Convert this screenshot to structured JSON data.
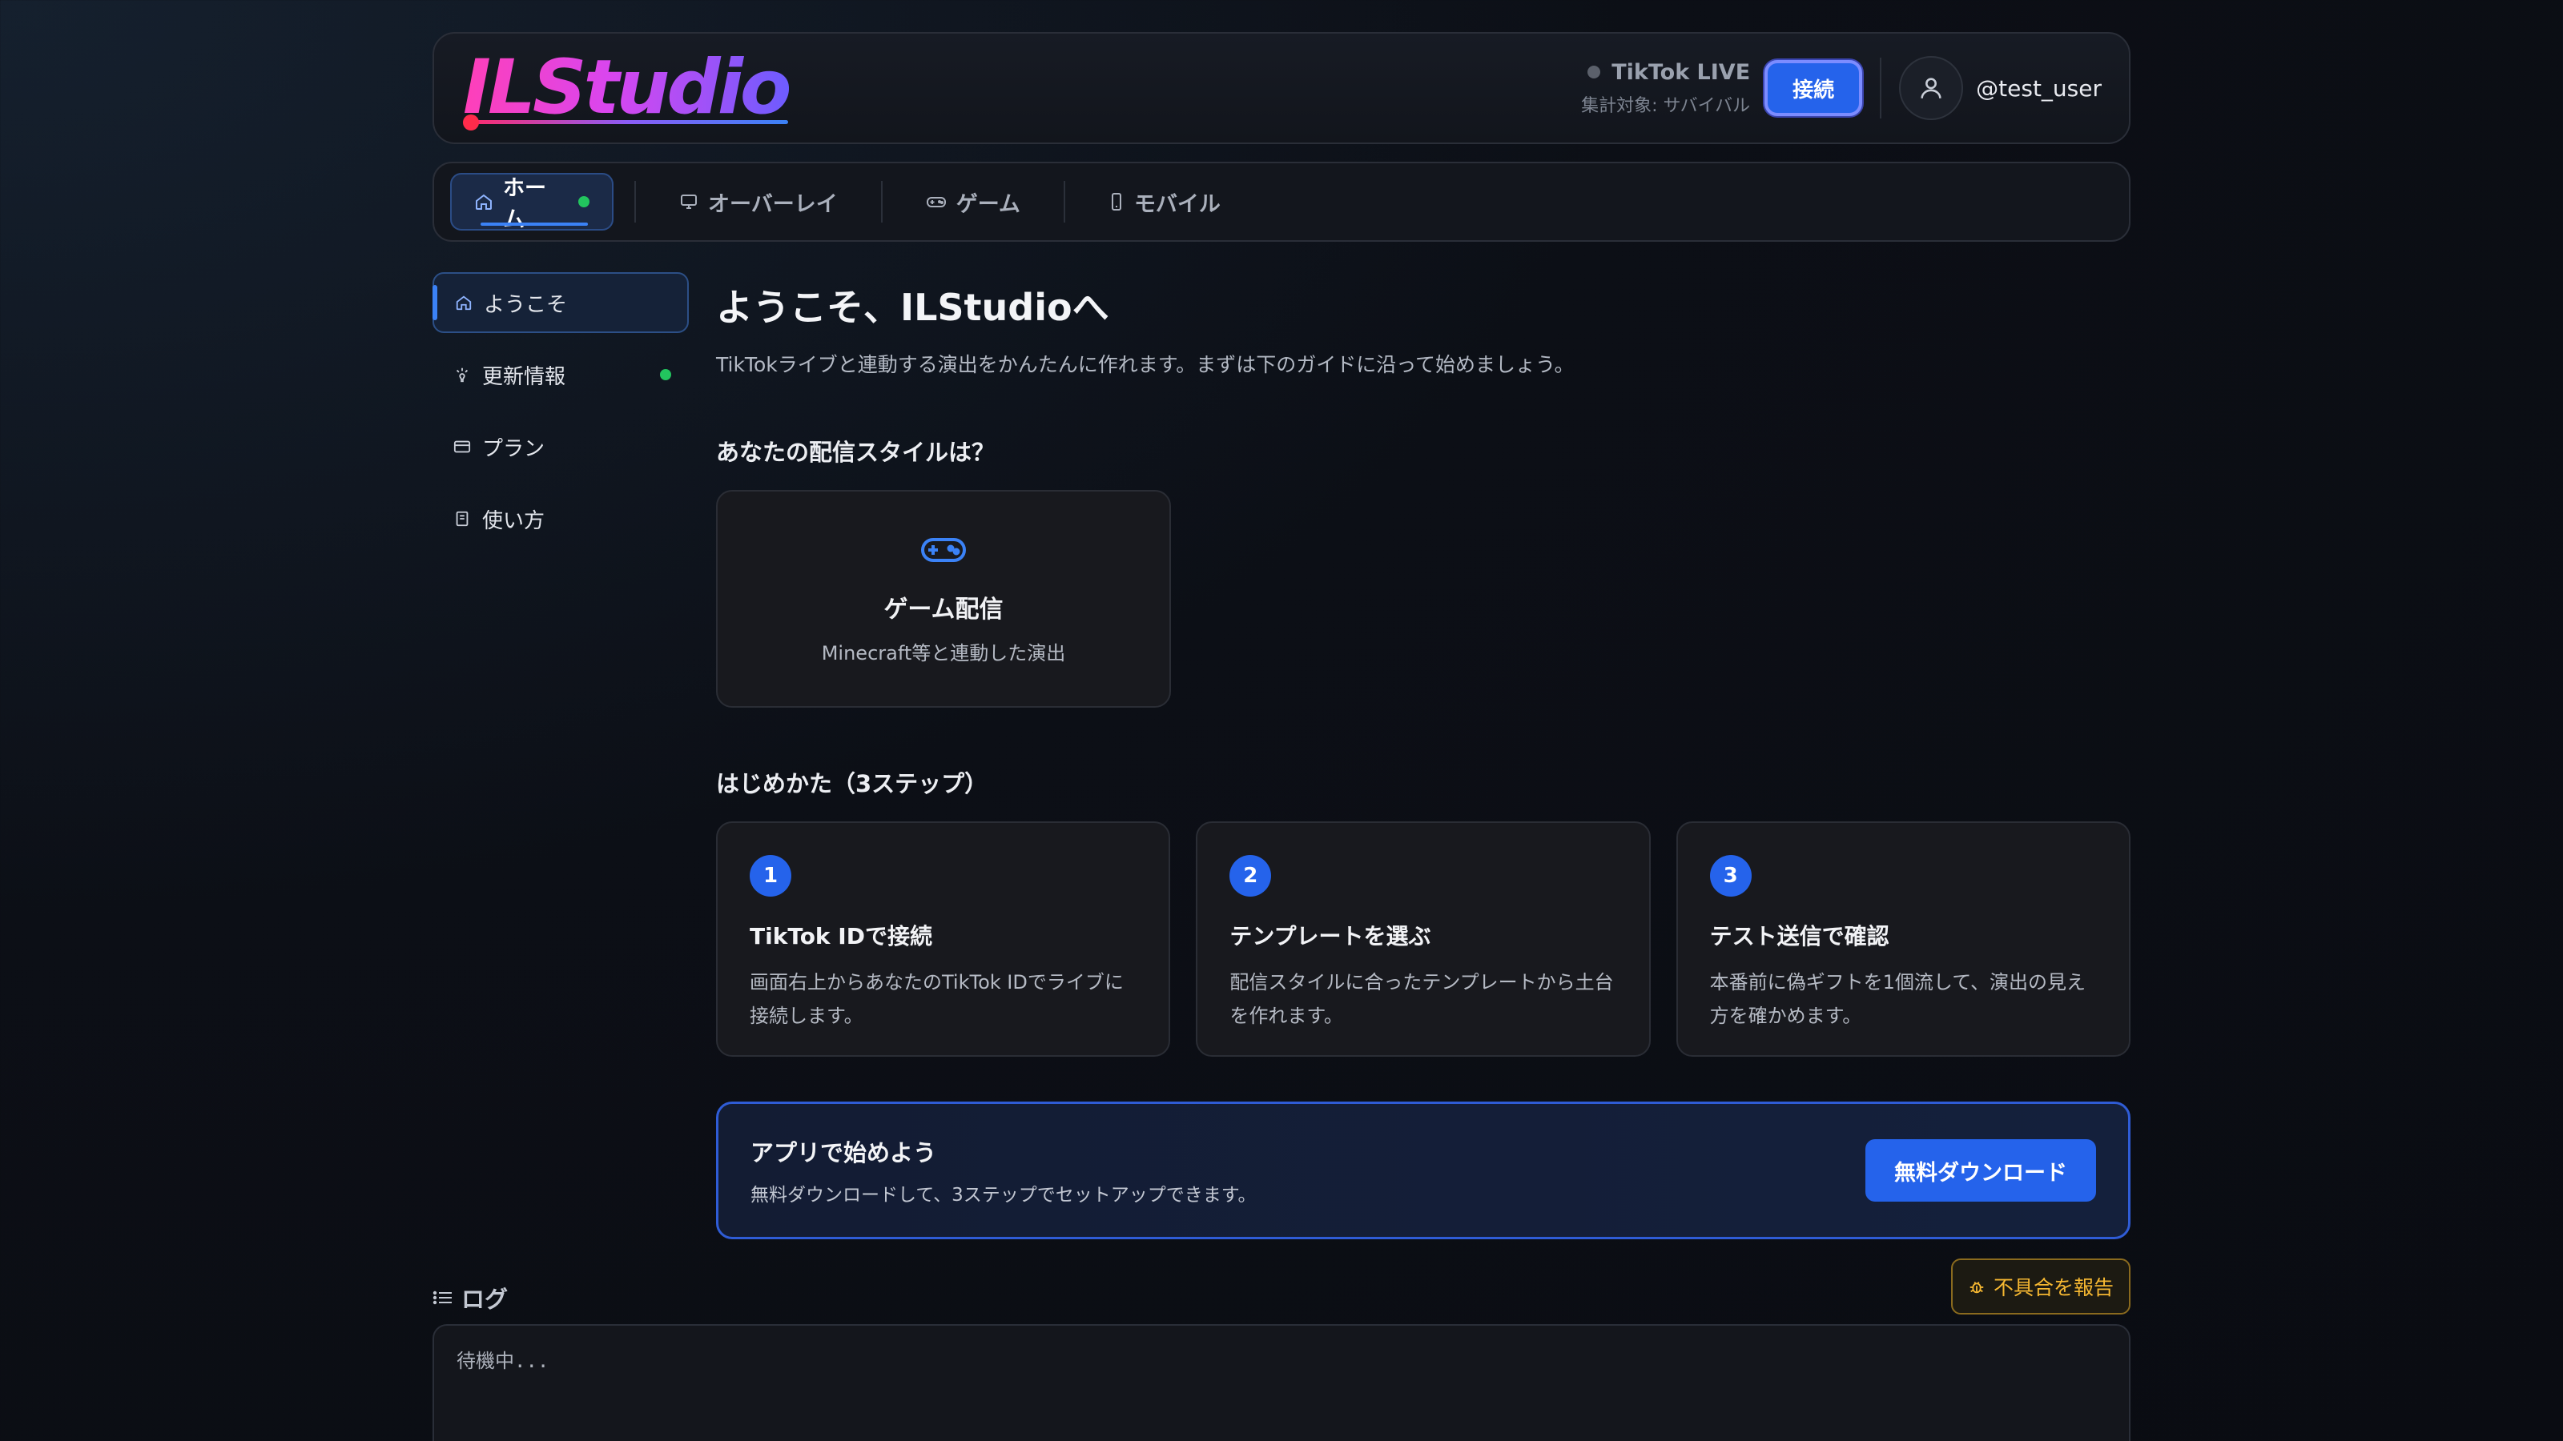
{
  "header": {
    "logo_text": "ILStudio",
    "live_label": "TikTok LIVE",
    "live_target": "集計対象: サバイバル",
    "connect_label": "接続",
    "username": "@test_user",
    "accent_color": "#2563eb"
  },
  "nav": {
    "tabs": [
      {
        "label": "ホーム",
        "icon": "home-icon",
        "active": true
      },
      {
        "label": "オーバーレイ",
        "icon": "monitor-icon"
      },
      {
        "label": "ゲーム",
        "icon": "gamepad-icon"
      },
      {
        "label": "モバイル",
        "icon": "smartphone-icon"
      }
    ]
  },
  "sidebar": {
    "items": [
      {
        "label": "ようこそ",
        "icon": "home-icon",
        "active": true
      },
      {
        "label": "更新情報",
        "icon": "sparkle-icon",
        "badge": true
      },
      {
        "label": "プラン",
        "icon": "card-icon"
      },
      {
        "label": "使い方",
        "icon": "book-icon"
      }
    ]
  },
  "main": {
    "title": "ようこそ、ILStudioへ",
    "lead": "TikTokライブと連動する演出をかんたんに作れます。まずは下のガイドに沿って始めましょう。",
    "style_heading": "あなたの配信スタイルは？",
    "style_card": {
      "title": "ゲーム配信",
      "subtitle": "Minecraft等と連動した演出",
      "icon": "gamepad-icon"
    },
    "steps_heading": "はじめかた（3ステップ）",
    "steps": [
      {
        "num": "1",
        "title": "TikTok IDで接続",
        "desc_1": "画面右上からあなたのTikTok IDでライブに",
        "desc_2": "接続します。"
      },
      {
        "num": "2",
        "title": "テンプレートを選ぶ",
        "desc_1": "配信スタイルに合ったテンプレートから土台",
        "desc_2": "を作れます。"
      },
      {
        "num": "3",
        "title": "テスト送信で確認",
        "desc_1": "本番前に偽ギフトを1個流して、演出の見え",
        "desc_2": "方を確かめます。"
      }
    ],
    "cta": {
      "title": "アプリで始めよう",
      "subtitle": "無料ダウンロードして、3ステップでセットアップできます。",
      "button": "無料ダウンロード"
    }
  },
  "bug_report": {
    "label": "不具合を報告",
    "color": "#f5b731"
  },
  "log": {
    "heading": "ログ",
    "text": "待機中..."
  }
}
